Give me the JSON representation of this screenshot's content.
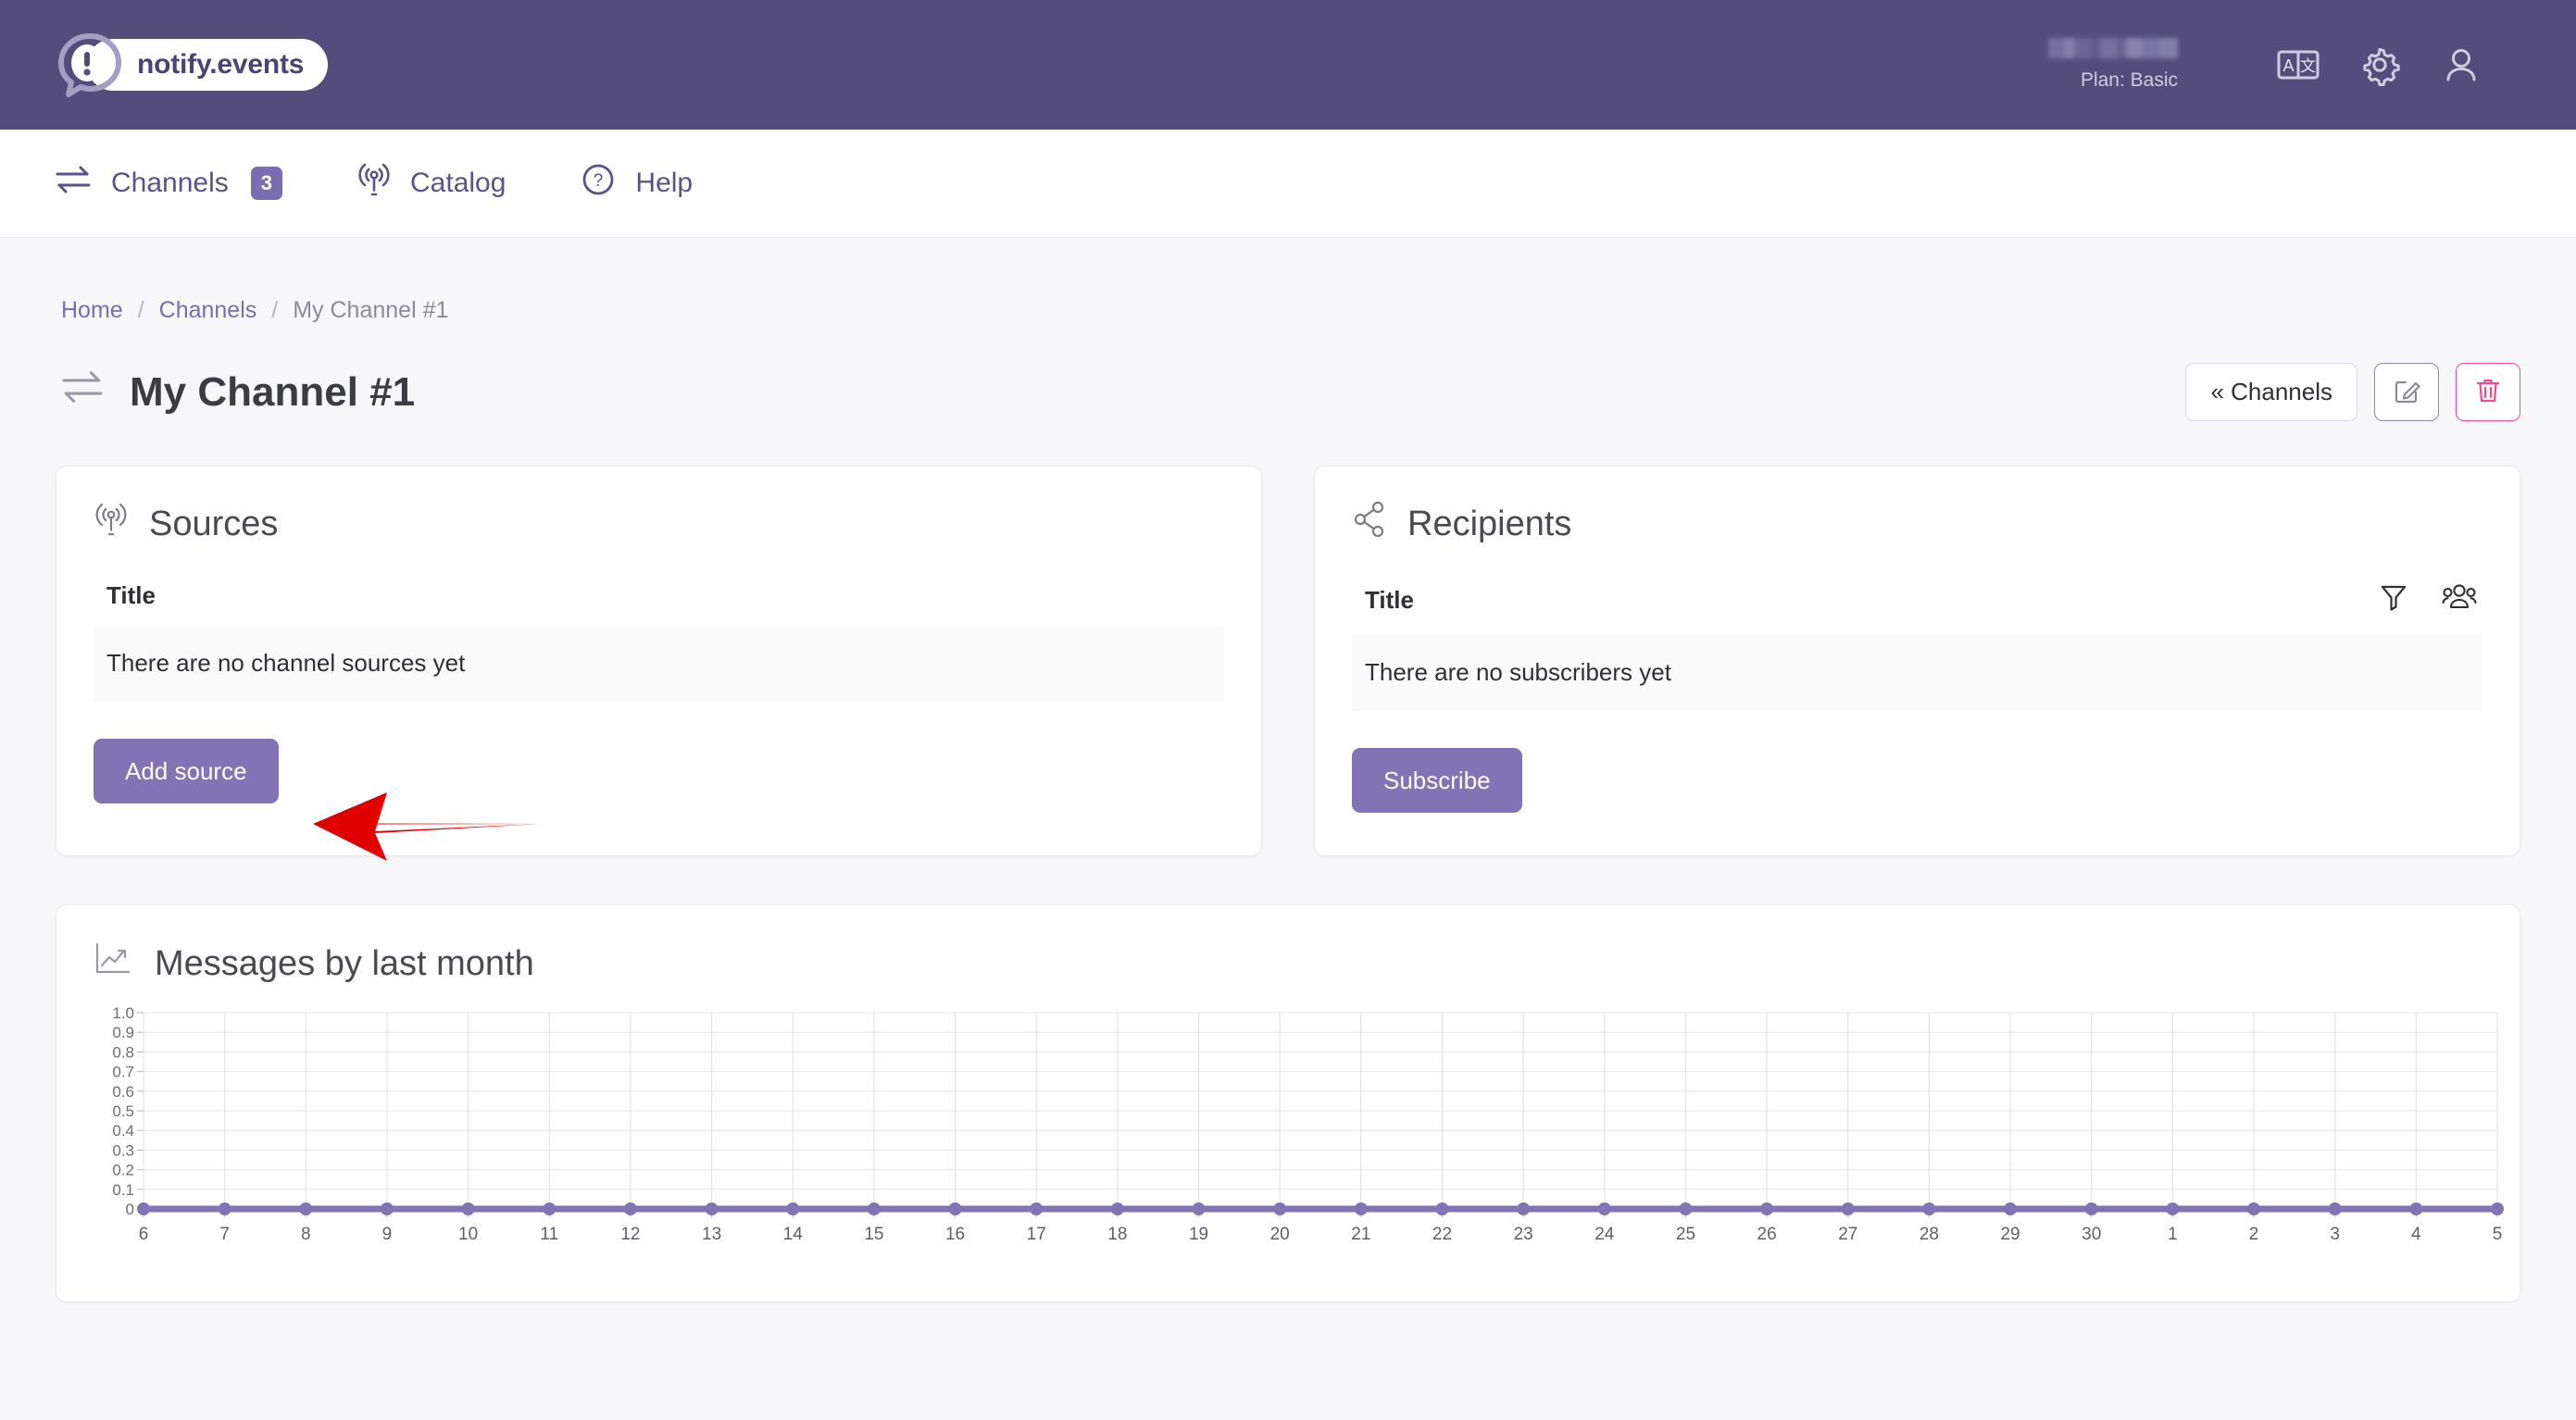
{
  "brand": {
    "name": "notify.events",
    "logo_icon": "exclamation-bubble-icon",
    "color": "#544d7c"
  },
  "topbar": {
    "username_redacted": "",
    "plan": "Plan: Basic",
    "icons": [
      "translate-icon",
      "gear-icon",
      "user-icon"
    ]
  },
  "nav": {
    "items": [
      {
        "label": "Channels",
        "icon": "exchange-arrows-icon",
        "badge": "3"
      },
      {
        "label": "Catalog",
        "icon": "broadcast-icon",
        "badge": ""
      },
      {
        "label": "Help",
        "icon": "question-circle-icon",
        "badge": ""
      }
    ]
  },
  "breadcrumb": {
    "home": "Home",
    "channels": "Channels",
    "current": "My Channel #1",
    "separator": "/"
  },
  "page": {
    "title": "My Channel #1",
    "title_icon": "exchange-arrows-icon",
    "actions": {
      "back_label": "« Channels",
      "edit_icon": "edit-pencil-icon",
      "delete_icon": "trash-icon"
    }
  },
  "sources_card": {
    "title": "Sources",
    "icon": "broadcast-icon",
    "column_title": "Title",
    "empty_message": "There are no channel sources yet",
    "button_label": "Add source"
  },
  "recipients_card": {
    "title": "Recipients",
    "icon": "share-nodes-icon",
    "column_title": "Title",
    "filter_icon": "filter-funnel-icon",
    "groups_icon": "users-group-icon",
    "empty_message": "There are no subscribers yet",
    "button_label": "Subscribe"
  },
  "chart_card": {
    "title": "Messages by last month",
    "icon": "line-chart-icon"
  },
  "annotation": {
    "type": "arrow",
    "direction": "left",
    "color": "#e00000",
    "points_to": "Add source"
  },
  "colors": {
    "brand_purple": "#544d7c",
    "accent_purple": "#7a6db0",
    "button_purple": "#8273b4",
    "pink": "#ec4d8e",
    "series_purple": "#8273b4"
  },
  "chart_data": {
    "type": "line",
    "title": "Messages by last month",
    "xlabel": "",
    "ylabel": "",
    "x": [
      "6",
      "7",
      "8",
      "9",
      "10",
      "11",
      "12",
      "13",
      "14",
      "15",
      "16",
      "17",
      "18",
      "19",
      "20",
      "21",
      "22",
      "23",
      "24",
      "25",
      "26",
      "27",
      "28",
      "29",
      "30",
      "1",
      "2",
      "3",
      "4",
      "5"
    ],
    "values": [
      0,
      0,
      0,
      0,
      0,
      0,
      0,
      0,
      0,
      0,
      0,
      0,
      0,
      0,
      0,
      0,
      0,
      0,
      0,
      0,
      0,
      0,
      0,
      0,
      0,
      0,
      0,
      0,
      0,
      0
    ],
    "yticks": [
      "1.0",
      "0.9",
      "0.8",
      "0.7",
      "0.6",
      "0.5",
      "0.4",
      "0.3",
      "0.2",
      "0.1",
      "0"
    ],
    "ylim": [
      0,
      1
    ],
    "grid": true,
    "legend": "none",
    "series": [
      {
        "name": "Messages",
        "color": "#8273b4",
        "values": [
          0,
          0,
          0,
          0,
          0,
          0,
          0,
          0,
          0,
          0,
          0,
          0,
          0,
          0,
          0,
          0,
          0,
          0,
          0,
          0,
          0,
          0,
          0,
          0,
          0,
          0,
          0,
          0,
          0,
          0
        ]
      }
    ]
  }
}
